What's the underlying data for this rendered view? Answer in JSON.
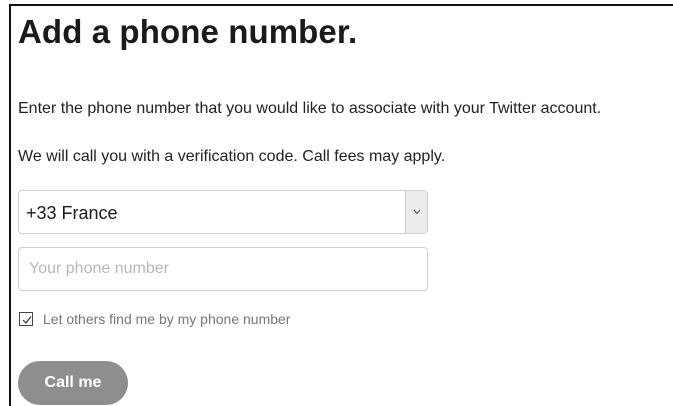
{
  "page": {
    "title": "Add a phone number.",
    "instruction": "Enter the phone number that you would like to associate with your Twitter account.",
    "call_notice": "We will call you with a verification code. Call fees may apply."
  },
  "form": {
    "country": {
      "selected": "+33 France"
    },
    "phone": {
      "placeholder": "Your phone number",
      "value": ""
    },
    "discoverable": {
      "checked": true,
      "label": "Let others find me by my phone number"
    },
    "submit_label": "Call me"
  },
  "colors": {
    "button_bg": "#8e8e8e",
    "placeholder": "#b8b8b8",
    "border": "#cfcfcf"
  },
  "icons": {
    "select_arrow": "chevron-down-icon",
    "checkbox": "checkmark-icon"
  }
}
